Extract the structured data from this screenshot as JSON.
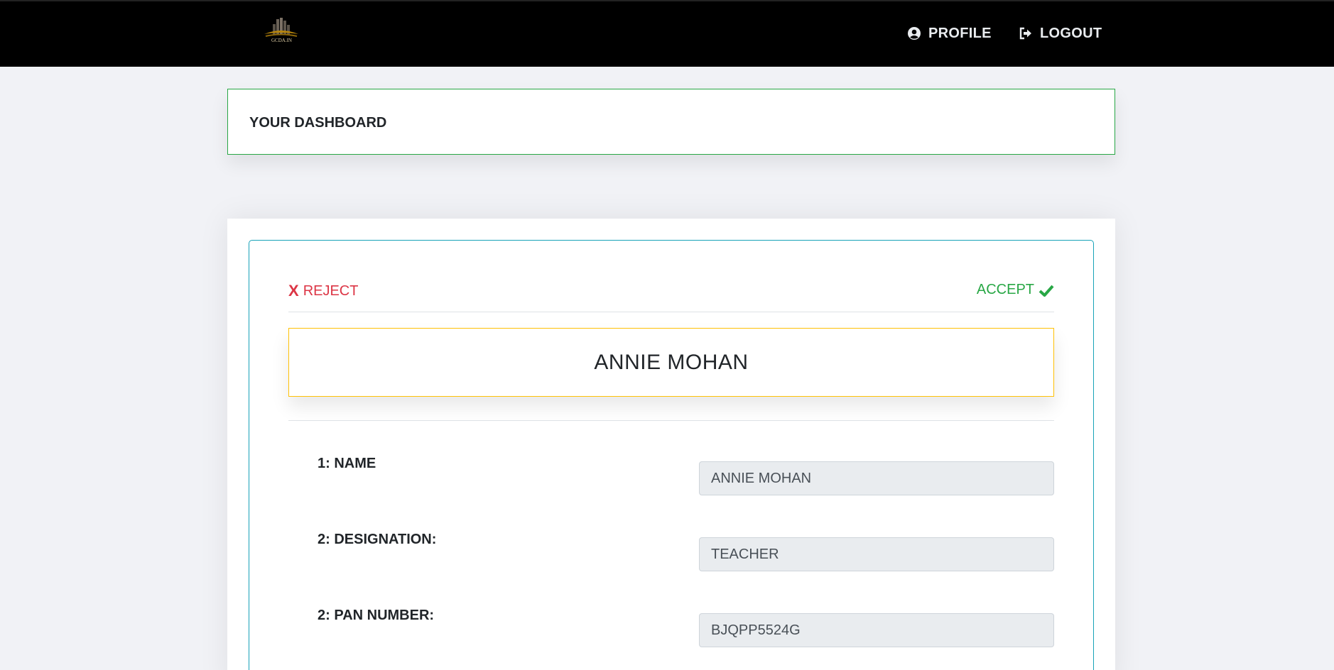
{
  "navbar": {
    "logo_text": "GCDA.IN",
    "profile_label": "PROFILE",
    "logout_label": "LOGOUT"
  },
  "dashboard": {
    "title": "YOUR DASHBOARD"
  },
  "actions": {
    "reject_symbol": "X",
    "reject_label": "REJECT",
    "accept_label": "ACCEPT"
  },
  "applicant": {
    "name": "ANNIE MOHAN"
  },
  "fields": [
    {
      "label": "1: NAME",
      "value": "ANNIE MOHAN"
    },
    {
      "label": "2: DESIGNATION:",
      "value": "TEACHER"
    },
    {
      "label": "2: PAN NUMBER:",
      "value": "BJQPP5524G"
    }
  ],
  "colors": {
    "navbar_bg": "#000000",
    "dashboard_border": "#28a745",
    "card_border": "#17a2b8",
    "name_box_border": "#ffc107",
    "reject": "#dc3545",
    "accept": "#28a745"
  }
}
